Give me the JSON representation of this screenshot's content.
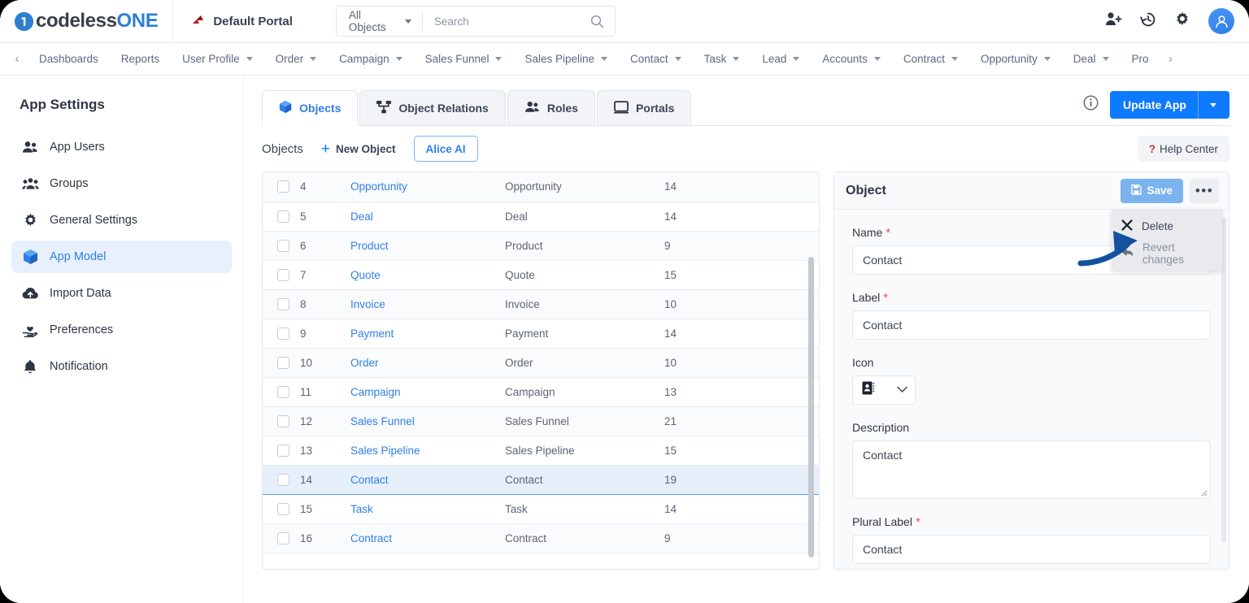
{
  "brand": {
    "logo_first": "codeless",
    "logo_second": "ONE",
    "logo_mark": "one-circle-icon"
  },
  "topbar": {
    "portal_name": "Default Portal",
    "portal_icon": "portal-logo-icon",
    "scope_selector": "All Objects",
    "search_placeholder": "Search",
    "search_value": "",
    "icons": [
      "add-user-icon",
      "history-icon",
      "gear-icon",
      "user-avatar-icon"
    ]
  },
  "nav": {
    "prev_label": "‹",
    "next_label": "›",
    "items": [
      {
        "label": "Dashboards",
        "has_caret": false
      },
      {
        "label": "Reports",
        "has_caret": false
      },
      {
        "label": "User Profile",
        "has_caret": true
      },
      {
        "label": "Order",
        "has_caret": true
      },
      {
        "label": "Campaign",
        "has_caret": true
      },
      {
        "label": "Sales Funnel",
        "has_caret": true
      },
      {
        "label": "Sales Pipeline",
        "has_caret": true
      },
      {
        "label": "Contact",
        "has_caret": true
      },
      {
        "label": "Task",
        "has_caret": true
      },
      {
        "label": "Lead",
        "has_caret": true
      },
      {
        "label": "Accounts",
        "has_caret": true
      },
      {
        "label": "Contract",
        "has_caret": true
      },
      {
        "label": "Opportunity",
        "has_caret": true
      },
      {
        "label": "Deal",
        "has_caret": true
      },
      {
        "label": "Pro",
        "has_caret": false
      }
    ]
  },
  "sidebar": {
    "title": "App Settings",
    "items": [
      {
        "label": "App Users",
        "icon": "users-icon",
        "active": false
      },
      {
        "label": "Groups",
        "icon": "group-icon",
        "active": false
      },
      {
        "label": "General Settings",
        "icon": "gear-icon",
        "active": false
      },
      {
        "label": "App Model",
        "icon": "cube-icon",
        "active": true
      },
      {
        "label": "Import Data",
        "icon": "cloud-upload-icon",
        "active": false
      },
      {
        "label": "Preferences",
        "icon": "hand-heart-icon",
        "active": false
      },
      {
        "label": "Notification",
        "icon": "bell-icon",
        "active": false
      }
    ]
  },
  "tabs": [
    {
      "label": "Objects",
      "icon": "cube-icon",
      "active": true
    },
    {
      "label": "Object Relations",
      "icon": "relations-icon",
      "active": false
    },
    {
      "label": "Roles",
      "icon": "users-icon",
      "active": false
    },
    {
      "label": "Portals",
      "icon": "monitor-icon",
      "active": false
    }
  ],
  "tabs_right": {
    "info_icon": "info-icon",
    "update_app_label": "Update App",
    "update_app_caret": "chevron-down-icon"
  },
  "subbar": {
    "title": "Objects",
    "new_object_label": "New Object",
    "new_object_icon": "plus-icon",
    "alice_label": "Alice AI",
    "help_marker": "?",
    "help_label": "Help Center"
  },
  "table": {
    "rows": [
      {
        "id": "4",
        "name": "Opportunity",
        "label": "Opportunity",
        "count": "14",
        "selected": false
      },
      {
        "id": "5",
        "name": "Deal",
        "label": "Deal",
        "count": "14",
        "selected": false
      },
      {
        "id": "6",
        "name": "Product",
        "label": "Product",
        "count": "9",
        "selected": false
      },
      {
        "id": "7",
        "name": "Quote",
        "label": "Quote",
        "count": "15",
        "selected": false
      },
      {
        "id": "8",
        "name": "Invoice",
        "label": "Invoice",
        "count": "10",
        "selected": false
      },
      {
        "id": "9",
        "name": "Payment",
        "label": "Payment",
        "count": "14",
        "selected": false
      },
      {
        "id": "10",
        "name": "Order",
        "label": "Order",
        "count": "10",
        "selected": false
      },
      {
        "id": "11",
        "name": "Campaign",
        "label": "Campaign",
        "count": "13",
        "selected": false
      },
      {
        "id": "12",
        "name": "Sales Funnel",
        "label": "Sales Funnel",
        "count": "21",
        "selected": false
      },
      {
        "id": "13",
        "name": "Sales Pipeline",
        "label": "Sales Pipeline",
        "count": "15",
        "selected": false
      },
      {
        "id": "14",
        "name": "Contact",
        "label": "Contact",
        "count": "19",
        "selected": true
      },
      {
        "id": "15",
        "name": "Task",
        "label": "Task",
        "count": "14",
        "selected": false
      },
      {
        "id": "16",
        "name": "Contract",
        "label": "Contract",
        "count": "9",
        "selected": false
      }
    ]
  },
  "panel": {
    "title": "Object",
    "save_label": "Save",
    "save_icon": "floppy-icon",
    "more_icon": "ellipsis-icon",
    "menu": [
      {
        "label": "Delete",
        "icon": "close-x-icon",
        "muted": false
      },
      {
        "label": "Revert changes",
        "icon": "undo-arrow-icon",
        "muted": true
      }
    ],
    "fields": {
      "name_label": "Name",
      "name_value": "Contact",
      "label_label": "Label",
      "label_value": "Contact",
      "icon_label": "Icon",
      "icon_value": "contact-card-icon",
      "description_label": "Description",
      "description_value": "Contact",
      "plural_label_label": "Plural Label",
      "plural_label_value": "Contact"
    }
  },
  "colors": {
    "accent": "#0d7aff",
    "link": "#2f7fe8",
    "selected_row": "#e6f0fb",
    "required": "#e8564f",
    "annotation_arrow": "#12529e"
  }
}
